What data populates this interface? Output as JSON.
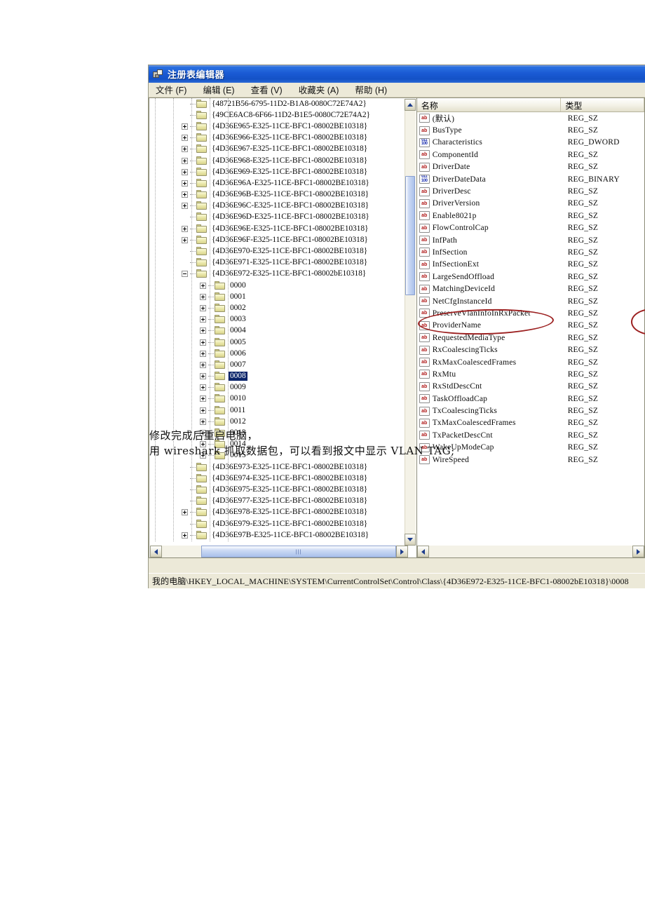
{
  "window": {
    "title": "注册表编辑器",
    "icon": "regedit-icon",
    "menu": [
      "文件 (F)",
      "编辑 (E)",
      "查看 (V)",
      "收藏夹 (A)",
      "帮助 (H)"
    ]
  },
  "tree": {
    "nodes": [
      {
        "label": "{48721B56-6795-11D2-B1A8-0080C72E74A2}",
        "depth": 0,
        "toggle": "none"
      },
      {
        "label": "{49CE6AC8-6F66-11D2-B1E5-0080C72E74A2}",
        "depth": 0,
        "toggle": "none"
      },
      {
        "label": "{4D36E965-E325-11CE-BFC1-08002BE10318}",
        "depth": 0,
        "toggle": "plus"
      },
      {
        "label": "{4D36E966-E325-11CE-BFC1-08002BE10318}",
        "depth": 0,
        "toggle": "plus"
      },
      {
        "label": "{4D36E967-E325-11CE-BFC1-08002BE10318}",
        "depth": 0,
        "toggle": "plus"
      },
      {
        "label": "{4D36E968-E325-11CE-BFC1-08002BE10318}",
        "depth": 0,
        "toggle": "plus"
      },
      {
        "label": "{4D36E969-E325-11CE-BFC1-08002BE10318}",
        "depth": 0,
        "toggle": "plus"
      },
      {
        "label": "{4D36E96A-E325-11CE-BFC1-08002BE10318}",
        "depth": 0,
        "toggle": "plus"
      },
      {
        "label": "{4D36E96B-E325-11CE-BFC1-08002BE10318}",
        "depth": 0,
        "toggle": "plus"
      },
      {
        "label": "{4D36E96C-E325-11CE-BFC1-08002BE10318}",
        "depth": 0,
        "toggle": "plus"
      },
      {
        "label": "{4D36E96D-E325-11CE-BFC1-08002BE10318}",
        "depth": 0,
        "toggle": "none"
      },
      {
        "label": "{4D36E96E-E325-11CE-BFC1-08002BE10318}",
        "depth": 0,
        "toggle": "plus"
      },
      {
        "label": "{4D36E96F-E325-11CE-BFC1-08002BE10318}",
        "depth": 0,
        "toggle": "plus"
      },
      {
        "label": "{4D36E970-E325-11CE-BFC1-08002BE10318}",
        "depth": 0,
        "toggle": "none"
      },
      {
        "label": "{4D36E971-E325-11CE-BFC1-08002BE10318}",
        "depth": 0,
        "toggle": "none"
      },
      {
        "label": "{4D36E972-E325-11CE-BFC1-08002bE10318}",
        "depth": 0,
        "toggle": "minus"
      },
      {
        "label": "0000",
        "depth": 1,
        "toggle": "plus"
      },
      {
        "label": "0001",
        "depth": 1,
        "toggle": "plus"
      },
      {
        "label": "0002",
        "depth": 1,
        "toggle": "plus"
      },
      {
        "label": "0003",
        "depth": 1,
        "toggle": "plus"
      },
      {
        "label": "0004",
        "depth": 1,
        "toggle": "plus"
      },
      {
        "label": "0005",
        "depth": 1,
        "toggle": "plus"
      },
      {
        "label": "0006",
        "depth": 1,
        "toggle": "plus"
      },
      {
        "label": "0007",
        "depth": 1,
        "toggle": "plus"
      },
      {
        "label": "0008",
        "depth": 1,
        "toggle": "plus",
        "selected": true
      },
      {
        "label": "0009",
        "depth": 1,
        "toggle": "plus"
      },
      {
        "label": "0010",
        "depth": 1,
        "toggle": "plus"
      },
      {
        "label": "0011",
        "depth": 1,
        "toggle": "plus"
      },
      {
        "label": "0012",
        "depth": 1,
        "toggle": "plus"
      },
      {
        "label": "0013",
        "depth": 1,
        "toggle": "plus"
      },
      {
        "label": "0014",
        "depth": 1,
        "toggle": "plus"
      },
      {
        "label": "0015",
        "depth": 1,
        "toggle": "plus"
      },
      {
        "label": "{4D36E973-E325-11CE-BFC1-08002BE10318}",
        "depth": 0,
        "toggle": "none"
      },
      {
        "label": "{4D36E974-E325-11CE-BFC1-08002BE10318}",
        "depth": 0,
        "toggle": "none"
      },
      {
        "label": "{4D36E975-E325-11CE-BFC1-08002BE10318}",
        "depth": 0,
        "toggle": "none"
      },
      {
        "label": "{4D36E977-E325-11CE-BFC1-08002BE10318}",
        "depth": 0,
        "toggle": "none"
      },
      {
        "label": "{4D36E978-E325-11CE-BFC1-08002BE10318}",
        "depth": 0,
        "toggle": "plus"
      },
      {
        "label": "{4D36E979-E325-11CE-BFC1-08002BE10318}",
        "depth": 0,
        "toggle": "none"
      },
      {
        "label": "{4D36E97B-E325-11CE-BFC1-08002BE10318}",
        "depth": 0,
        "toggle": "plus"
      }
    ]
  },
  "values": {
    "columns": [
      "名称",
      "类型"
    ],
    "rows": [
      {
        "name": "(默认)",
        "type": "REG_SZ",
        "icon": "string-value-icon"
      },
      {
        "name": "BusType",
        "type": "REG_SZ",
        "icon": "string-value-icon"
      },
      {
        "name": "Characteristics",
        "type": "REG_DWORD",
        "icon": "binary-value-icon"
      },
      {
        "name": "ComponentId",
        "type": "REG_SZ",
        "icon": "string-value-icon"
      },
      {
        "name": "DriverDate",
        "type": "REG_SZ",
        "icon": "string-value-icon"
      },
      {
        "name": "DriverDateData",
        "type": "REG_BINARY",
        "icon": "binary-value-icon"
      },
      {
        "name": "DriverDesc",
        "type": "REG_SZ",
        "icon": "string-value-icon"
      },
      {
        "name": "DriverVersion",
        "type": "REG_SZ",
        "icon": "string-value-icon"
      },
      {
        "name": "Enable8021p",
        "type": "REG_SZ",
        "icon": "string-value-icon"
      },
      {
        "name": "FlowControlCap",
        "type": "REG_SZ",
        "icon": "string-value-icon"
      },
      {
        "name": "InfPath",
        "type": "REG_SZ",
        "icon": "string-value-icon"
      },
      {
        "name": "InfSection",
        "type": "REG_SZ",
        "icon": "string-value-icon"
      },
      {
        "name": "InfSectionExt",
        "type": "REG_SZ",
        "icon": "string-value-icon"
      },
      {
        "name": "LargeSendOffload",
        "type": "REG_SZ",
        "icon": "string-value-icon"
      },
      {
        "name": "MatchingDeviceId",
        "type": "REG_SZ",
        "icon": "string-value-icon"
      },
      {
        "name": "NetCfgInstanceId",
        "type": "REG_SZ",
        "icon": "string-value-icon"
      },
      {
        "name": "PreserveVlanInfoInRxPacket",
        "type": "REG_SZ",
        "icon": "string-value-icon",
        "highlighted": true
      },
      {
        "name": "ProviderName",
        "type": "REG_SZ",
        "icon": "string-value-icon"
      },
      {
        "name": "RequestedMediaType",
        "type": "REG_SZ",
        "icon": "string-value-icon"
      },
      {
        "name": "RxCoalescingTicks",
        "type": "REG_SZ",
        "icon": "string-value-icon"
      },
      {
        "name": "RxMaxCoalescedFrames",
        "type": "REG_SZ",
        "icon": "string-value-icon"
      },
      {
        "name": "RxMtu",
        "type": "REG_SZ",
        "icon": "string-value-icon"
      },
      {
        "name": "RxStdDescCnt",
        "type": "REG_SZ",
        "icon": "string-value-icon"
      },
      {
        "name": "TaskOffloadCap",
        "type": "REG_SZ",
        "icon": "string-value-icon"
      },
      {
        "name": "TxCoalescingTicks",
        "type": "REG_SZ",
        "icon": "string-value-icon"
      },
      {
        "name": "TxMaxCoalescedFrames",
        "type": "REG_SZ",
        "icon": "string-value-icon"
      },
      {
        "name": "TxPacketDescCnt",
        "type": "REG_SZ",
        "icon": "string-value-icon"
      },
      {
        "name": "WakeUpModeCap",
        "type": "REG_SZ",
        "icon": "string-value-icon"
      },
      {
        "name": "WireSpeed",
        "type": "REG_SZ",
        "icon": "string-value-icon"
      }
    ]
  },
  "status": {
    "path": "我的电脑\\HKEY_LOCAL_MACHINE\\SYSTEM\\CurrentControlSet\\Control\\Class\\{4D36E972-E325-11CE-BFC1-08002bE10318}\\0008"
  },
  "annotations": {
    "line1": "修改完成后重启电脑，",
    "line2": "用 wireshark 抓取数据包，可以看到报文中显示 VLAN TAG;",
    "ellipse_color": "#9c2020"
  },
  "icon_glyphs": {
    "string": "ab",
    "binary": "011\n100"
  }
}
